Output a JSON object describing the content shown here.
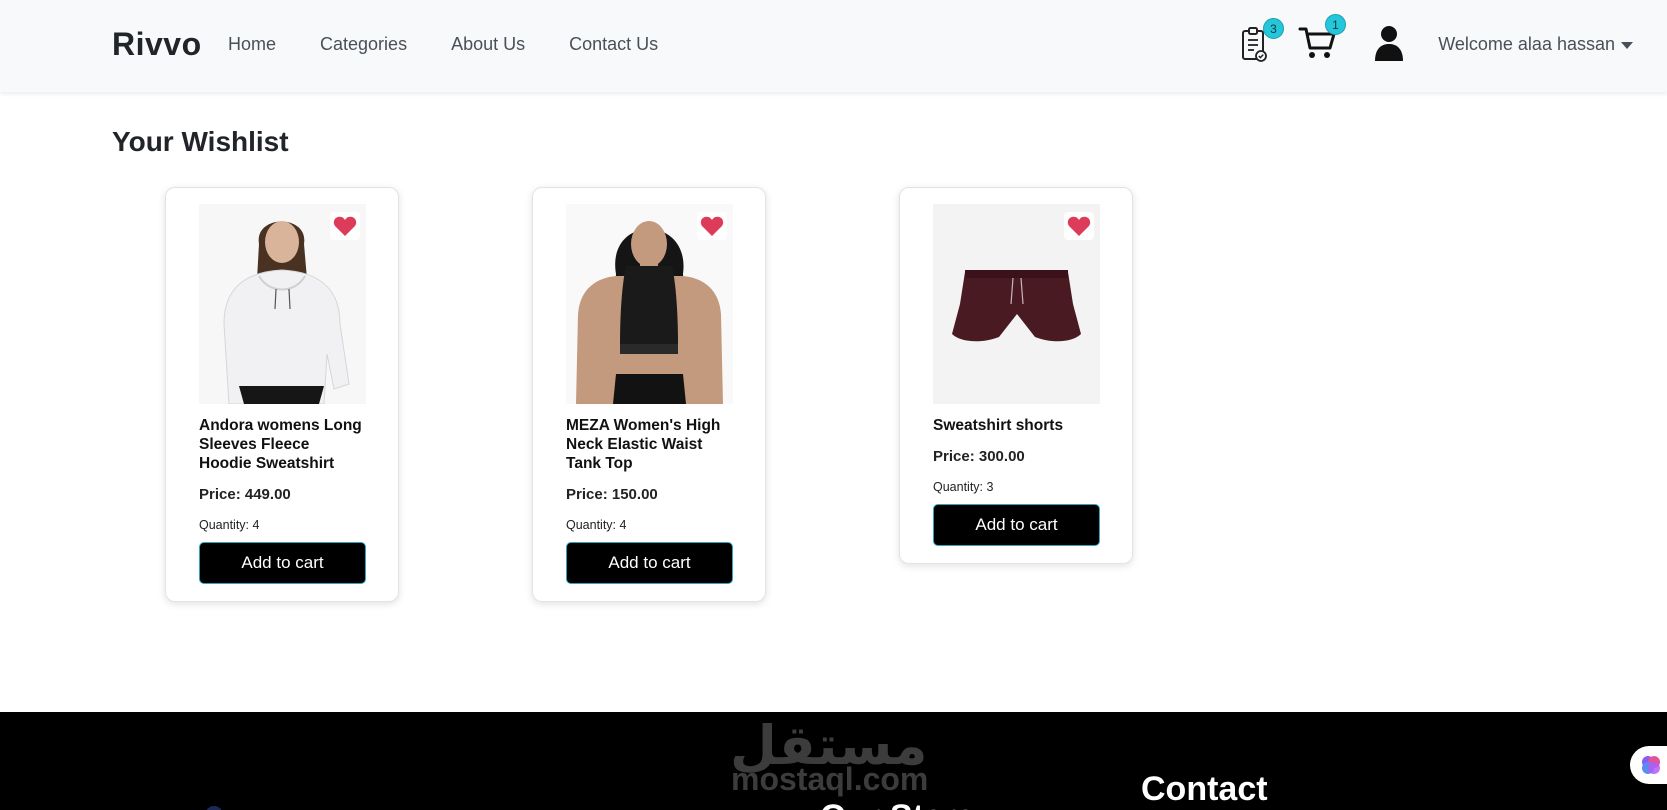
{
  "nav": {
    "brand": "Rivvo",
    "links": [
      "Home",
      "Categories",
      "About Us",
      "Contact Us"
    ],
    "wishlist_badge": "3",
    "cart_badge": "1",
    "welcome": "Welcome alaa hassan"
  },
  "page": {
    "title": "Your Wishlist"
  },
  "items": [
    {
      "title": "Andora womens Long Sleeves Fleece Hoodie Sweatshirt",
      "price_label": "Price:",
      "price": "449.00",
      "quantity_label": "Quantity:",
      "quantity": "4",
      "button": "Add to cart"
    },
    {
      "title": "MEZA Women's High Neck Elastic Waist Tank Top",
      "price_label": "Price:",
      "price": "150.00",
      "quantity_label": "Quantity:",
      "quantity": "4",
      "button": "Add to cart"
    },
    {
      "title": "Sweatshirt shorts",
      "price_label": "Price:",
      "price": "300.00",
      "quantity_label": "Quantity:",
      "quantity": "3",
      "button": "Add to cart"
    }
  ],
  "footer": {
    "watermark_ar": "مستقل",
    "watermark_en": "mostaql.com",
    "contact_heading": "Contact",
    "stars_heading": "Our Stars"
  },
  "colors": {
    "heart": "#dc3b5a",
    "badge": "#26c6da",
    "button_bg": "#000000",
    "button_border": "#2fa4c0"
  },
  "icons": {
    "wishlist": "clipboard-list-icon",
    "cart": "shopping-cart-icon",
    "user": "user-icon",
    "favorite": "heart-icon"
  }
}
